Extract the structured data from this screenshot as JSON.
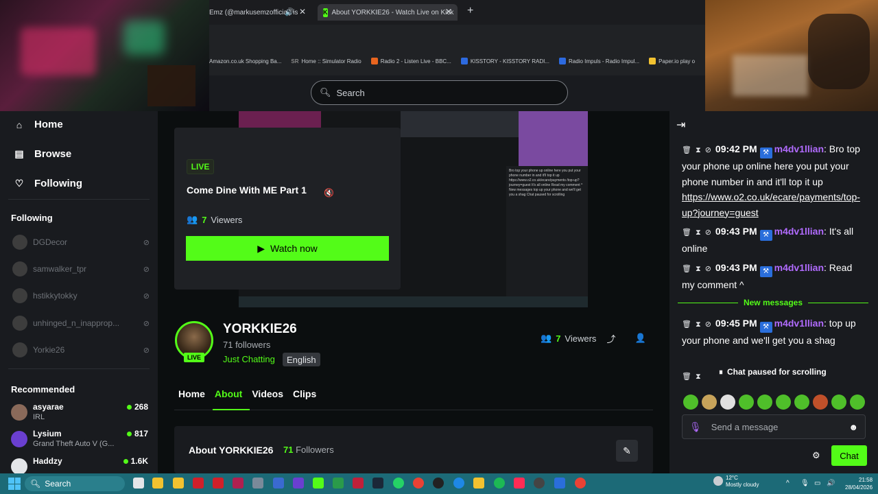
{
  "browser": {
    "tabs": [
      {
        "label": "Emz (@markusemzofficial) is",
        "active": false
      },
      {
        "label": "About YORKKIE26 - Watch Live on Kick",
        "active": true
      }
    ],
    "new_tab": "+",
    "bookmarks": [
      {
        "label": "Amazon.co.uk Shopping Ba...",
        "color": "#ffffff"
      },
      {
        "label": "Home :: Simulator Radio",
        "prefix": "SR",
        "color": "#555555"
      },
      {
        "label": "Radio 2 - Listen Live - BBC...",
        "color": "#e8651f"
      },
      {
        "label": "KISSTORY - KISSTORY RADI...",
        "color": "#2d6adf"
      },
      {
        "label": "Radio Impuls - Radio Impul...",
        "color": "#2d6adf"
      },
      {
        "label": "Paper.io play o",
        "color": "#f2c230"
      }
    ]
  },
  "search": {
    "placeholder": "Search"
  },
  "sidebar": {
    "nav": [
      {
        "label": "Home",
        "icon": "home-icon"
      },
      {
        "label": "Browse",
        "icon": "browse-icon"
      },
      {
        "label": "Following",
        "icon": "heart-icon"
      }
    ],
    "following_title": "Following",
    "following": [
      "DGDecor",
      "samwalker_tpr",
      "hstikkytokky",
      "unhinged_n_inapprop...",
      "Yorkie26"
    ],
    "recommended_title": "Recommended",
    "recommended": [
      {
        "name": "asyarae",
        "category": "IRL",
        "viewers": "268",
        "color": "#8a6a5a"
      },
      {
        "name": "Lysium",
        "category": "Grand Theft Auto V (G...",
        "viewers": "817",
        "color": "#6a3fd0"
      },
      {
        "name": "Haddzy",
        "category": "",
        "viewers": "1.6K",
        "color": "#e3e5e8"
      }
    ]
  },
  "player": {
    "preview_chat": "Bro top your phone up online here you put your phone number in and it'll top it up https://www.o2.co.uk/ecare/payments /top-up?journey=guest It's all online Read my comment ^ New messages top up your phone and we'll get you a shag Chat paused for scrolling"
  },
  "stream_card": {
    "live_label": "LIVE",
    "title": "Come Dine With ME Part 1",
    "viewers_count": "7",
    "viewers_label": "Viewers",
    "watch_label": "Watch now"
  },
  "channel": {
    "name": "YORKKIE26",
    "followers": "71 followers",
    "category": "Just Chatting",
    "language": "English",
    "live_badge": "LIVE",
    "viewers_count": "7",
    "viewers_label": "Viewers",
    "tabs": [
      "Home",
      "About",
      "Videos",
      "Clips"
    ],
    "active_tab": "About",
    "about_title": "About YORKKIE26",
    "about_followers_count": "71",
    "about_followers_label": "Followers"
  },
  "chat": {
    "messages": [
      {
        "time": "09:42 PM",
        "user": "m4dv1llian",
        "text": ": Bro top your phone up online here you put your phone number in and it'll top it up ",
        "link": "https://www.o2.co.uk/ecare/payments/top-up?journey=guest"
      },
      {
        "time": "09:43 PM",
        "user": "m4dv1llian",
        "text": ": It's all online"
      },
      {
        "time": "09:43 PM",
        "user": "m4dv1llian",
        "text": ": Read my comment ^"
      },
      {
        "time": "09:45 PM",
        "user": "m4dv1llian",
        "text": ": top up your phone and we'll get you a shag"
      }
    ],
    "new_messages_label": "New messages",
    "paused_label": "Chat paused for scrolling",
    "input_placeholder": "Send a message",
    "send_label": "Chat",
    "badge_color": "#2a6edb",
    "username_color": "#b16bff"
  },
  "taskbar": {
    "search_label": "Search",
    "weather_temp": "12°C",
    "weather_desc": "Mostly cloudy",
    "time": "21:58",
    "date": "28/04/2026"
  },
  "colors": {
    "accent": "#53fc18",
    "taskbar": "#1c6a77"
  }
}
